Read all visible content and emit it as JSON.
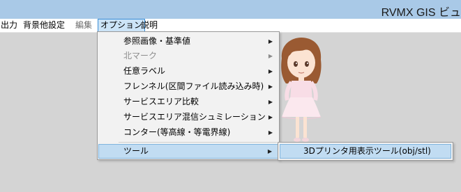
{
  "window": {
    "title": "RVMX GIS ビュ"
  },
  "menubar": {
    "items": [
      {
        "label": "出力",
        "state": "enabled"
      },
      {
        "label": "背景他設定",
        "state": "enabled"
      },
      {
        "label": "編集",
        "state": "disabled"
      },
      {
        "label": "オプション",
        "state": "open"
      },
      {
        "label": "説明",
        "state": "enabled"
      }
    ]
  },
  "options_menu": {
    "items": [
      {
        "label": "参照画像・基準値",
        "has_submenu": true,
        "state": "enabled"
      },
      {
        "label": "北マーク",
        "has_submenu": true,
        "state": "disabled"
      },
      {
        "label": "任意ラベル",
        "has_submenu": true,
        "state": "enabled"
      },
      {
        "label": "フレンネル(区間ファイル読み込み時)",
        "has_submenu": true,
        "state": "enabled"
      },
      {
        "label": "サービスエリア比較",
        "has_submenu": true,
        "state": "enabled"
      },
      {
        "label": "サービスエリア混信シュミレーション",
        "has_submenu": true,
        "state": "enabled"
      },
      {
        "label": "コンター(等高線・等電界線)",
        "has_submenu": true,
        "state": "enabled"
      },
      {
        "label": "ツール",
        "has_submenu": true,
        "state": "highlighted"
      }
    ]
  },
  "tools_submenu": {
    "items": [
      {
        "label": "3Dプリンタ用表示ツール(obj/stl)",
        "state": "highlighted"
      }
    ]
  },
  "icons": {
    "submenu_arrow": "▸",
    "mascot": "mascot-character-image"
  },
  "colors": {
    "titlebar": "#a9c9e7",
    "menu_highlight": "#c1dcf2",
    "menu_background": "#f2f2f2"
  }
}
